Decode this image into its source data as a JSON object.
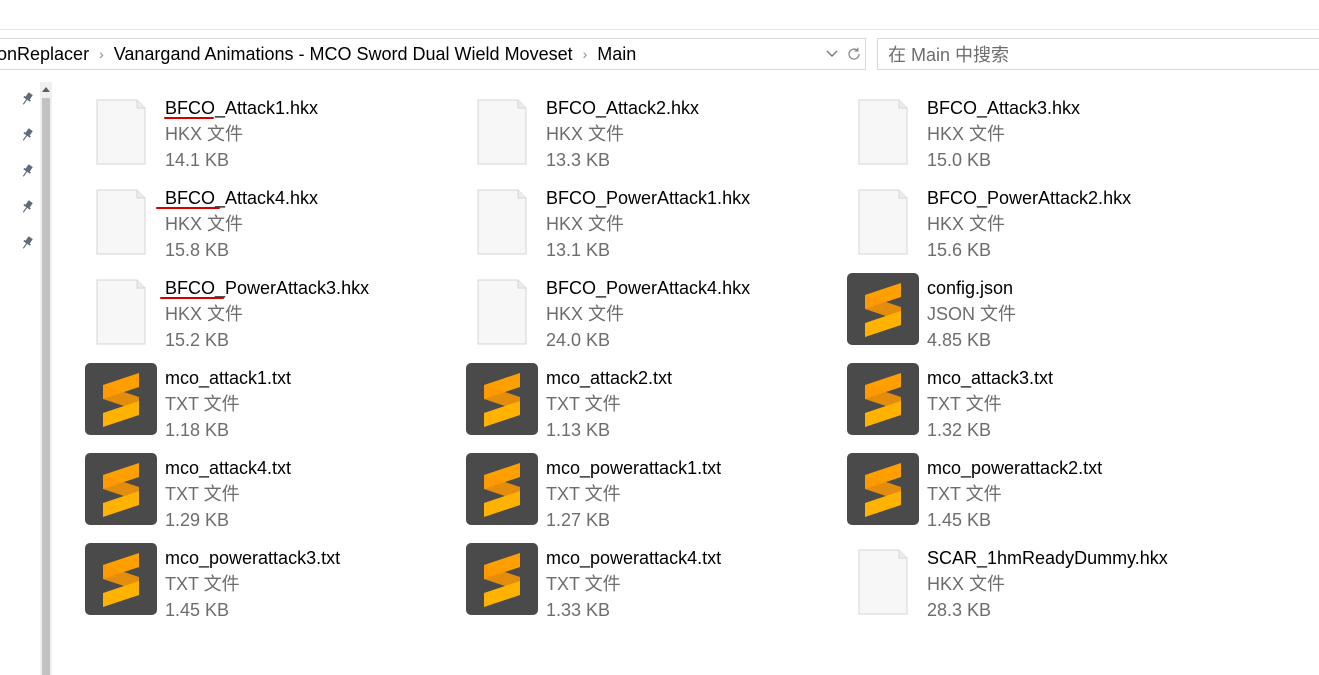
{
  "breadcrumb": {
    "items": [
      "onReplacer",
      "Vanargand Animations - MCO Sword Dual Wield Moveset",
      "Main"
    ],
    "separator": "›"
  },
  "search": {
    "placeholder": "在 Main 中搜索"
  },
  "nav": {
    "pins": [
      "pin-icon",
      "pin-icon",
      "pin-icon",
      "pin-icon",
      "pin-icon"
    ]
  },
  "files": [
    {
      "name": "BFCO_Attack1.hkx",
      "type": "HKX 文件",
      "size": "14.1 KB",
      "icon": "blank-file-icon",
      "underlined": true
    },
    {
      "name": "BFCO_Attack2.hkx",
      "type": "HKX 文件",
      "size": "13.3 KB",
      "icon": "blank-file-icon"
    },
    {
      "name": "BFCO_Attack3.hkx",
      "type": "HKX 文件",
      "size": "15.0 KB",
      "icon": "blank-file-icon"
    },
    {
      "name": "BFCO_Attack4.hkx",
      "type": "HKX 文件",
      "size": "15.8 KB",
      "icon": "blank-file-icon",
      "underlined": true
    },
    {
      "name": "BFCO_PowerAttack1.hkx",
      "type": "HKX 文件",
      "size": "13.1 KB",
      "icon": "blank-file-icon"
    },
    {
      "name": "BFCO_PowerAttack2.hkx",
      "type": "HKX 文件",
      "size": "15.6 KB",
      "icon": "blank-file-icon"
    },
    {
      "name": "BFCO_PowerAttack3.hkx",
      "type": "HKX 文件",
      "size": "15.2 KB",
      "icon": "blank-file-icon",
      "underlined": true
    },
    {
      "name": "BFCO_PowerAttack4.hkx",
      "type": "HKX 文件",
      "size": "24.0 KB",
      "icon": "blank-file-icon"
    },
    {
      "name": "config.json",
      "type": "JSON 文件",
      "size": "4.85 KB",
      "icon": "sublime-text-icon"
    },
    {
      "name": "mco_attack1.txt",
      "type": "TXT 文件",
      "size": "1.18 KB",
      "icon": "sublime-text-icon"
    },
    {
      "name": "mco_attack2.txt",
      "type": "TXT 文件",
      "size": "1.13 KB",
      "icon": "sublime-text-icon"
    },
    {
      "name": "mco_attack3.txt",
      "type": "TXT 文件",
      "size": "1.32 KB",
      "icon": "sublime-text-icon"
    },
    {
      "name": "mco_attack4.txt",
      "type": "TXT 文件",
      "size": "1.29 KB",
      "icon": "sublime-text-icon"
    },
    {
      "name": "mco_powerattack1.txt",
      "type": "TXT 文件",
      "size": "1.27 KB",
      "icon": "sublime-text-icon"
    },
    {
      "name": "mco_powerattack2.txt",
      "type": "TXT 文件",
      "size": "1.45 KB",
      "icon": "sublime-text-icon"
    },
    {
      "name": "mco_powerattack3.txt",
      "type": "TXT 文件",
      "size": "1.45 KB",
      "icon": "sublime-text-icon"
    },
    {
      "name": "mco_powerattack4.txt",
      "type": "TXT 文件",
      "size": "1.33 KB",
      "icon": "sublime-text-icon"
    },
    {
      "name": "SCAR_1hmReadyDummy.hkx",
      "type": "HKX 文件",
      "size": "28.3 KB",
      "icon": "blank-file-icon"
    }
  ],
  "colors": {
    "annotation_underline": "#d40000",
    "sublime_bg": "#4a4a4a",
    "sublime_orange": "#ff9800",
    "meta_text": "#6d6d6d"
  }
}
